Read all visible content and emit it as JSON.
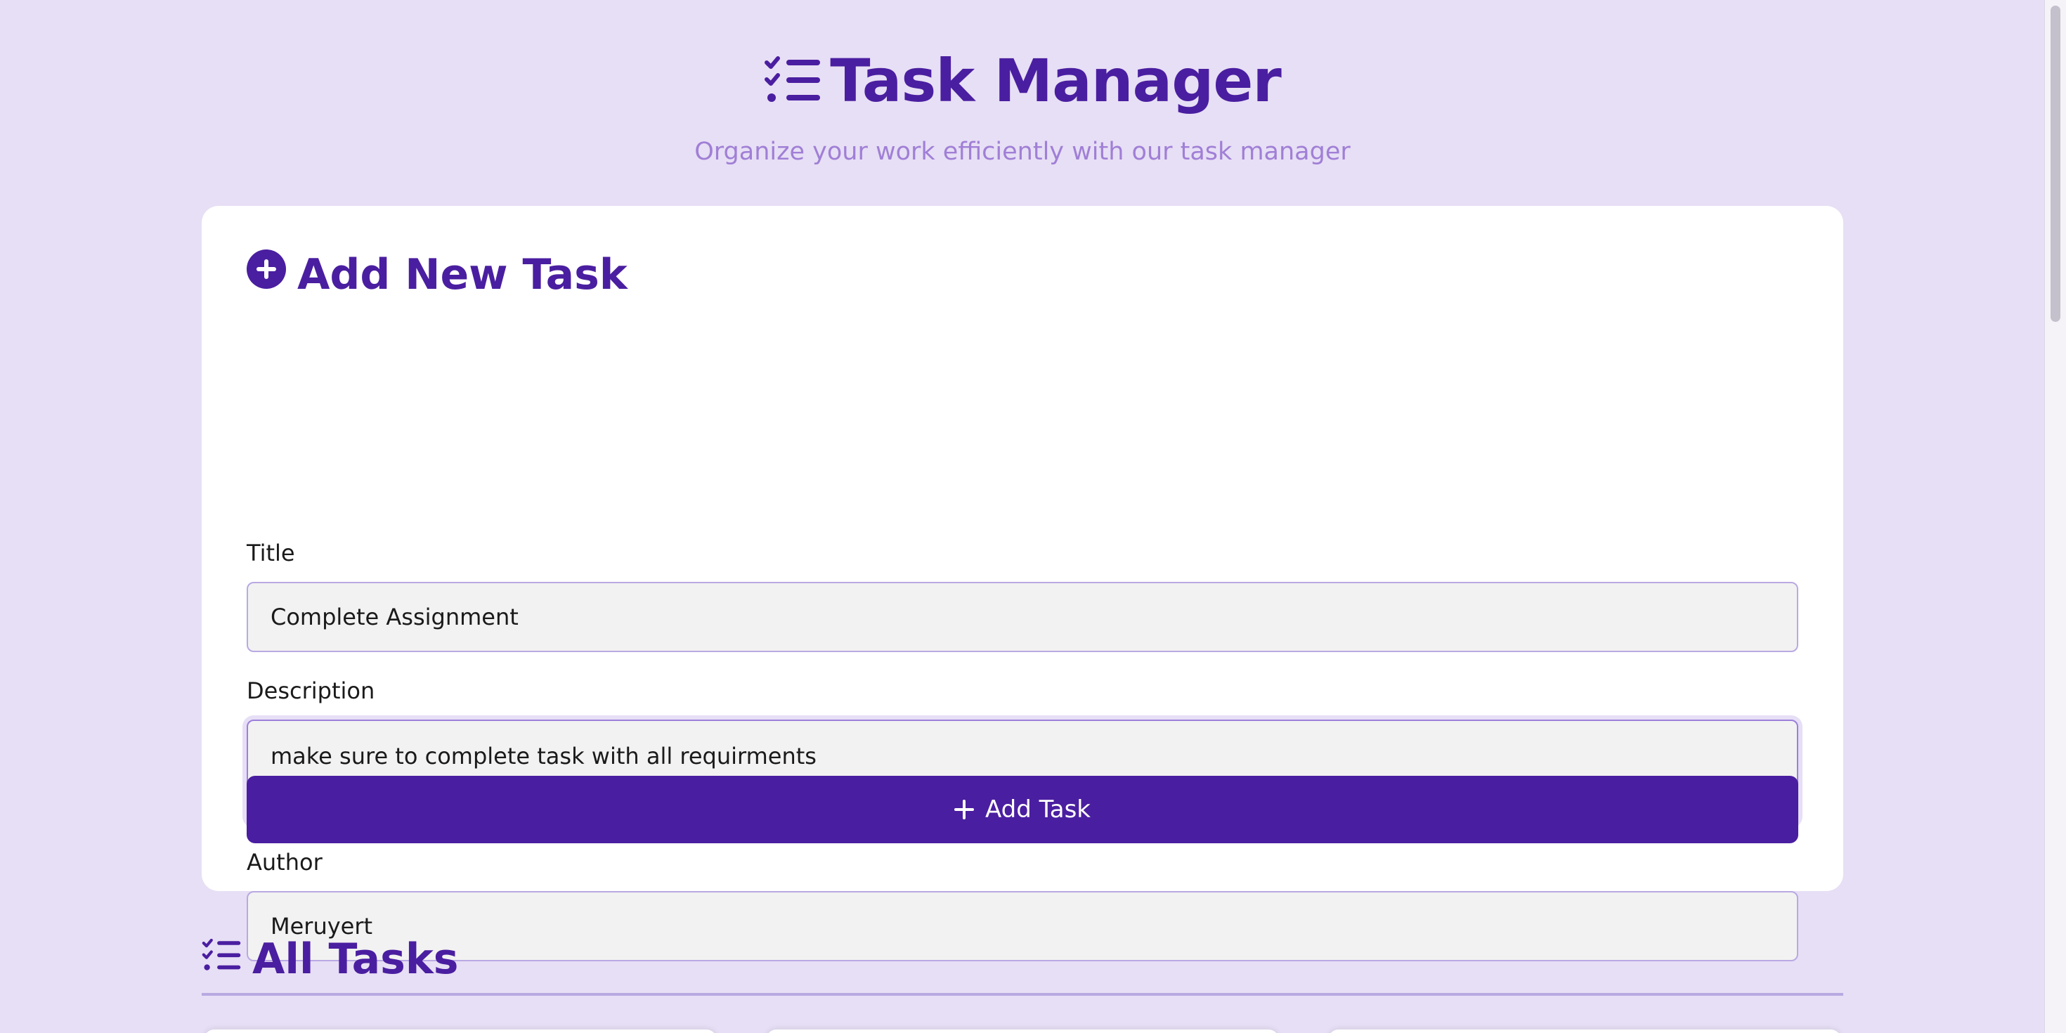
{
  "header": {
    "title": "Task Manager",
    "subtitle": "Organize your work efficiently with our task manager",
    "icon": "checklist-icon"
  },
  "form": {
    "heading": "Add New Task",
    "heading_icon": "plus-circle-icon",
    "title_label": "Title",
    "title_value": "Complete Assignment",
    "description_label": "Description",
    "description_value": "make sure to complete task with all requirments",
    "author_label": "Author",
    "author_value": "Meruyert",
    "submit_label": "Add Task",
    "submit_icon": "plus-icon"
  },
  "tasks": {
    "heading": "All Tasks",
    "heading_icon": "checklist-icon"
  },
  "colors": {
    "accent": "#4a1ea0",
    "background": "#e7dff5",
    "subtitle": "#a07fd6"
  }
}
